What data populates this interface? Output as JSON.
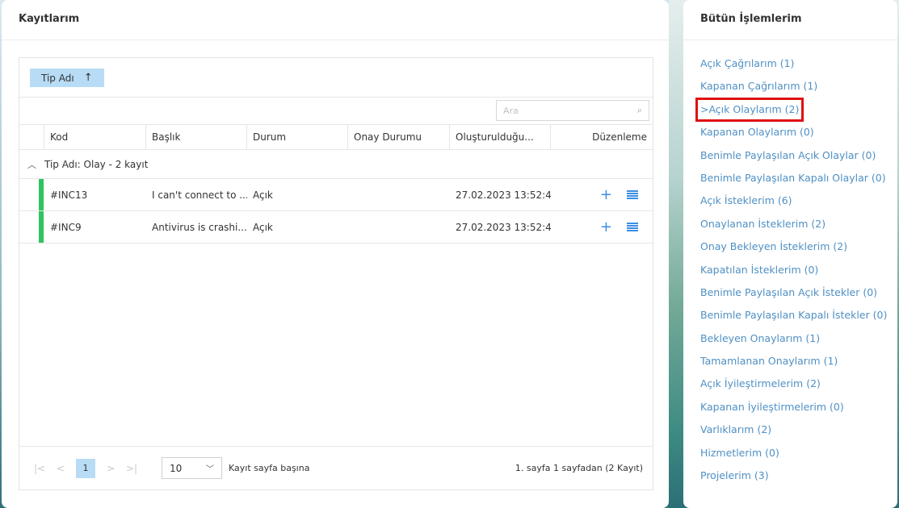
{
  "main": {
    "title": "Kayıtlarım",
    "group_chip": {
      "label": "Tip Adı",
      "arrow": "↑"
    },
    "search": {
      "placeholder": "Ara"
    },
    "columns": [
      "Kod",
      "Başlık",
      "Durum",
      "Onay Durumu",
      "Oluşturulduğu...",
      "Düzenleme"
    ],
    "group": {
      "label": "Tip Adı: Olay - 2 kayıt",
      "chevron": "^"
    },
    "rows": [
      {
        "kod": "#INC13",
        "baslik": "I can't connect to ...",
        "durum": "Açık",
        "onay": "",
        "tarih": "27.02.2023 13:52:48",
        "status_color": "#2ec45f"
      },
      {
        "kod": "#INC9",
        "baslik": "Antivirus is crashi...",
        "durum": "Açık",
        "onay": "",
        "tarih": "27.02.2023 13:52:48",
        "status_color": "#2ec45f"
      }
    ],
    "pager": {
      "first": "|<",
      "prev": "<",
      "current_page": "1",
      "next": ">",
      "last": ">|",
      "page_size": "10",
      "per_page_label": "Kayıt sayfa başına",
      "info": "1. sayfa 1 sayfadan (2 Kayıt)"
    }
  },
  "side": {
    "title": "Bütün İşlemlerim",
    "items": [
      "Açık Çağrılarım (1)",
      "Kapanan Çağrılarım (1)",
      ">Açık Olaylarım (2)",
      "Kapanan Olaylarım (0)",
      "Benimle Paylaşılan Açık Olaylar (0)",
      "Benimle Paylaşılan Kapalı Olaylar (0)",
      "Açık İsteklerim (6)",
      "Onaylanan İsteklerim (2)",
      "Onay Bekleyen İsteklerim (2)",
      "Kapatılan İsteklerim (0)",
      "Benimle Paylaşılan Açık İstekler (0)",
      "Benimle Paylaşılan Kapalı İstekler (0)",
      "Bekleyen Onaylarım (1)",
      "Tamamlanan Onaylarım (1)",
      "Açık İyileştirmelerim (2)",
      "Kapanan İyileştirmelerim (0)",
      "Varlıklarım (2)",
      "Hizmetlerim (0)",
      "Projelerim (3)"
    ],
    "active_index": 2
  },
  "colors": {
    "accent": "#4f90c4",
    "chip": "#b8dcf5",
    "status_open": "#2ec45f",
    "highlight_box": "#e01010"
  }
}
